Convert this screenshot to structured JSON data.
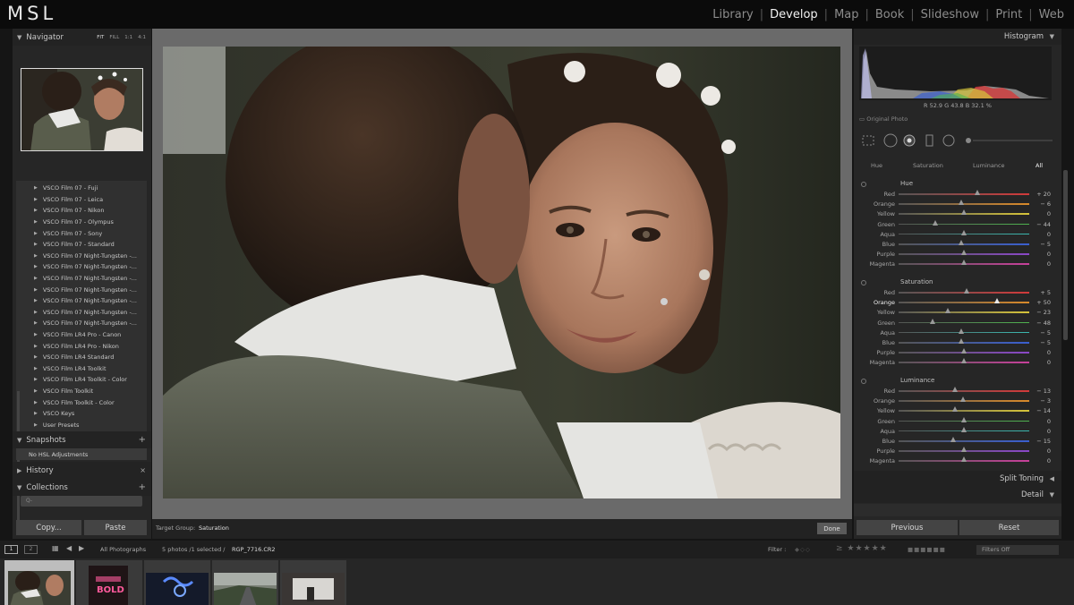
{
  "app": {
    "logo": "MSL"
  },
  "modules": [
    "Library",
    "Develop",
    "Map",
    "Book",
    "Slideshow",
    "Print",
    "Web"
  ],
  "active_module": "Develop",
  "left_panel": {
    "navigator": {
      "title": "Navigator",
      "options": [
        "FIT",
        "FILL",
        "1:1",
        "4:1"
      ]
    },
    "presets": [
      "VSCO Film 07 - Fuji",
      "VSCO Film 07 - Leica",
      "VSCO Film 07 - Nikon",
      "VSCO Film 07 - Olympus",
      "VSCO Film 07 - Sony",
      "VSCO Film 07 - Standard",
      "VSCO Film 07 Night-Tungsten -...",
      "VSCO Film 07 Night-Tungsten -...",
      "VSCO Film 07 Night-Tungsten -...",
      "VSCO Film 07 Night-Tungsten -...",
      "VSCO Film 07 Night-Tungsten -...",
      "VSCO Film 07 Night-Tungsten -...",
      "VSCO Film 07 Night-Tungsten -...",
      "VSCO Film LR4 Pro - Canon",
      "VSCO Film LR4 Pro - Nikon",
      "VSCO Film LR4 Standard",
      "VSCO Film LR4 Toolkit",
      "VSCO Film LR4 Toolkit - Color",
      "VSCO Film Toolkit",
      "VSCO Film Toolkit - Color",
      "VSCO Keys",
      "User Presets"
    ],
    "snapshots": {
      "title": "Snapshots",
      "item": "No HSL Adjustments"
    },
    "history": {
      "title": "History"
    },
    "collections": {
      "title": "Collections",
      "search_placeholder": "Q-"
    },
    "copy_label": "Copy...",
    "paste_label": "Paste"
  },
  "toolbar": {
    "target_group_label": "Target Group:",
    "target_group_value": "Saturation",
    "done_label": "Done"
  },
  "right_panel": {
    "histogram_title": "Histogram",
    "rgb_readout": "R  52.9  G  43.8  B  32.1 %",
    "original_photo_label": "Original Photo",
    "hsl_tabs": [
      "Hue",
      "Saturation",
      "Luminance",
      "All"
    ],
    "hsl_active_tab": "All",
    "sections": [
      {
        "title": "Hue",
        "rows": [
          {
            "label": "Red",
            "value": "+ 20",
            "level": 0.6
          },
          {
            "label": "Orange",
            "value": "− 6",
            "level": 0.48
          },
          {
            "label": "Yellow",
            "value": "0",
            "level": 0.5
          },
          {
            "label": "Green",
            "value": "− 44",
            "level": 0.28
          },
          {
            "label": "Aqua",
            "value": "0",
            "level": 0.5
          },
          {
            "label": "Blue",
            "value": "− 5",
            "level": 0.48
          },
          {
            "label": "Purple",
            "value": "0",
            "level": 0.5
          },
          {
            "label": "Magenta",
            "value": "0",
            "level": 0.5
          }
        ]
      },
      {
        "title": "Saturation",
        "rows": [
          {
            "label": "Red",
            "value": "+ 5",
            "level": 0.52
          },
          {
            "label": "Orange",
            "value": "+ 50",
            "level": 0.75,
            "active": true
          },
          {
            "label": "Yellow",
            "value": "− 23",
            "level": 0.38
          },
          {
            "label": "Green",
            "value": "− 48",
            "level": 0.26
          },
          {
            "label": "Aqua",
            "value": "− 5",
            "level": 0.48
          },
          {
            "label": "Blue",
            "value": "− 5",
            "level": 0.48
          },
          {
            "label": "Purple",
            "value": "0",
            "level": 0.5
          },
          {
            "label": "Magenta",
            "value": "0",
            "level": 0.5
          }
        ]
      },
      {
        "title": "Luminance",
        "rows": [
          {
            "label": "Red",
            "value": "− 13",
            "level": 0.43
          },
          {
            "label": "Orange",
            "value": "− 3",
            "level": 0.49
          },
          {
            "label": "Yellow",
            "value": "− 14",
            "level": 0.43
          },
          {
            "label": "Green",
            "value": "0",
            "level": 0.5
          },
          {
            "label": "Aqua",
            "value": "0",
            "level": 0.5
          },
          {
            "label": "Blue",
            "value": "− 15",
            "level": 0.42
          },
          {
            "label": "Purple",
            "value": "0",
            "level": 0.5
          },
          {
            "label": "Magenta",
            "value": "0",
            "level": 0.5
          }
        ]
      }
    ],
    "split_toning_title": "Split Toning",
    "detail_title": "Detail",
    "previous_label": "Previous",
    "reset_label": "Reset"
  },
  "filmstrip": {
    "monitor_1": "1",
    "monitor_2": "2",
    "source": "All Photographs",
    "count_text": "5 photos /1 selected /",
    "filename": "RGP_7716.CR2",
    "filter_label": "Filter :",
    "filters_off": "Filters Off",
    "thumbnails": [
      {
        "name": "couple-photo",
        "selected": true
      },
      {
        "name": "neon-bold-sign"
      },
      {
        "name": "neon-sign-blue"
      },
      {
        "name": "road-landscape"
      },
      {
        "name": "window-interior"
      }
    ]
  },
  "colors": {
    "accent_active_text": "#f2f2f2",
    "panel_bg": "#262626",
    "slider_colors": {
      "Red": "#d23a3a",
      "Orange": "#d98a2a",
      "Yellow": "#d6c43a",
      "Green": "#4fb44f",
      "Aqua": "#3ab9b0",
      "Blue": "#3a5fd0",
      "Purple": "#8a48c8",
      "Magenta": "#c8409a"
    }
  }
}
